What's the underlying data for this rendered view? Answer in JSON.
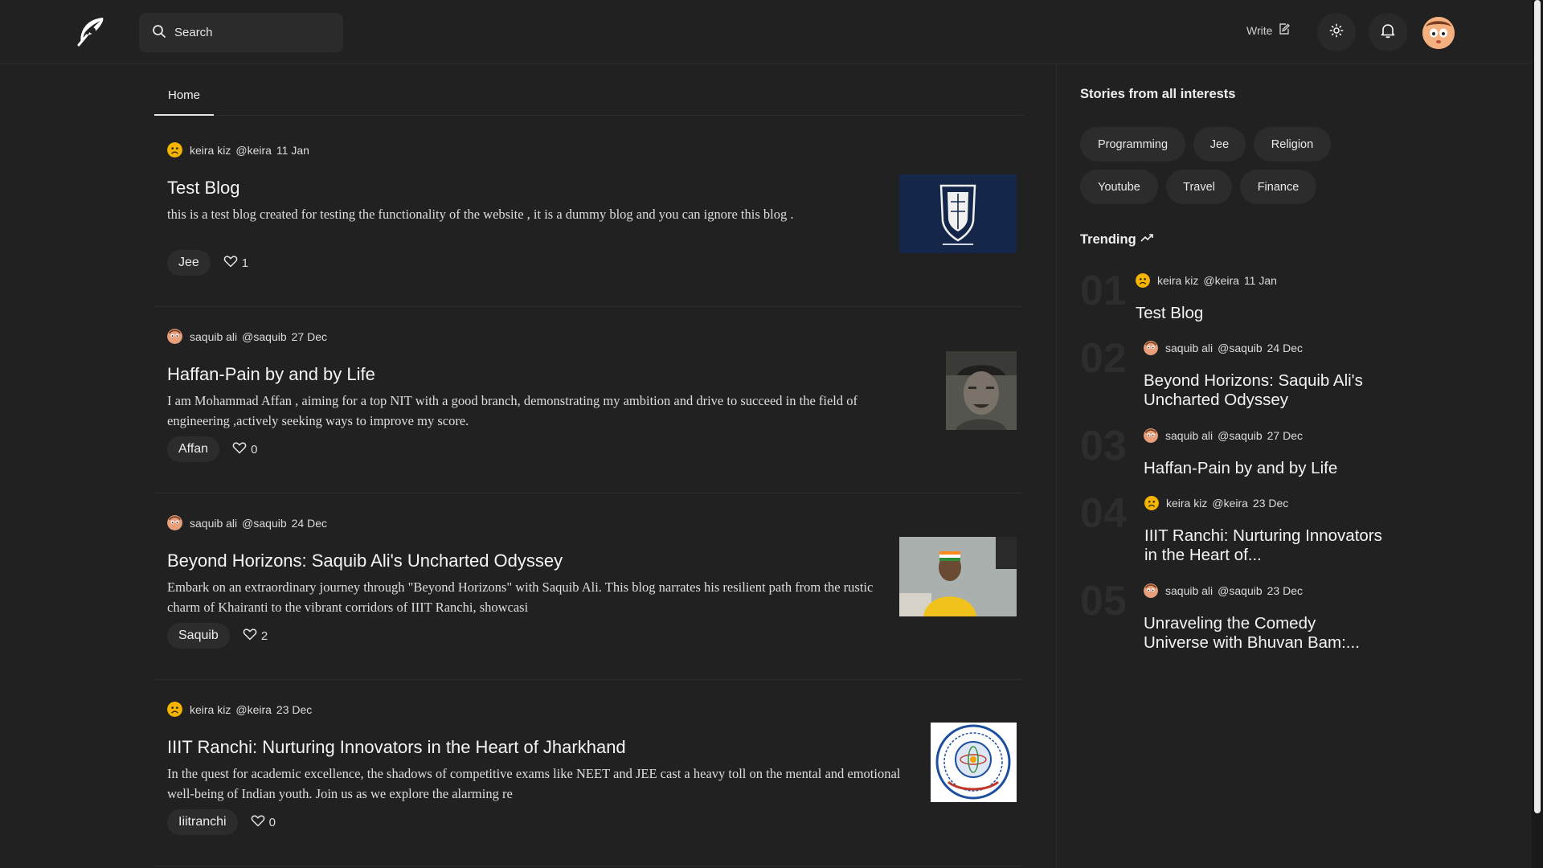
{
  "header": {
    "search_label": "Search",
    "write_label": "Write"
  },
  "tabs": [
    {
      "label": "Home"
    }
  ],
  "posts": [
    {
      "author": "keira kiz",
      "handle": "@keira",
      "date": "11 Jan",
      "title": "Test Blog",
      "excerpt": "this is a test blog created for testing the functionality of the website , it is a dummy blog and you can ignore this blog .",
      "tag": "Jee",
      "likes": "1"
    },
    {
      "author": "saquib ali",
      "handle": "@saquib",
      "date": "27 Dec",
      "title": "Haffan-Pain by and by Life",
      "excerpt": "I am Mohammad Affan , aiming for a top NIT with a good branch, demonstrating my ambition and drive to succeed in the field of engineering ,actively seeking ways to improve my score.",
      "tag": "Affan",
      "likes": "0"
    },
    {
      "author": "saquib ali",
      "handle": "@saquib",
      "date": "24 Dec",
      "title": "Beyond Horizons: Saquib Ali's Uncharted Odyssey",
      "excerpt": "Embark on an extraordinary journey through \"Beyond Horizons\" with Saquib Ali. This blog narrates his resilient path from the rustic charm of Khairanti to the vibrant corridors of IIIT Ranchi, showcasi",
      "tag": "Saquib",
      "likes": "2"
    },
    {
      "author": "keira kiz",
      "handle": "@keira",
      "date": "23 Dec",
      "title": "IIIT Ranchi: Nurturing Innovators in the Heart of Jharkhand",
      "excerpt": "In the quest for academic excellence, the shadows of competitive exams like NEET and JEE cast a heavy toll on the mental and emotional well-being of Indian youth. Join us as we explore the alarming re",
      "tag": "Iiitranchi",
      "likes": "0"
    }
  ],
  "sidebar": {
    "interests_title": "Stories from all interests",
    "interests": [
      "Programming",
      "Jee",
      "Religion",
      "Youtube",
      "Travel",
      "Finance"
    ],
    "trending_title": "Trending",
    "trending": [
      {
        "num": "01",
        "author": "keira kiz",
        "handle": "@keira",
        "date": "11 Jan",
        "title": "Test Blog"
      },
      {
        "num": "02",
        "author": "saquib ali",
        "handle": "@saquib",
        "date": "24 Dec",
        "title": "Beyond Horizons: Saquib Ali's Uncharted Odyssey"
      },
      {
        "num": "03",
        "author": "saquib ali",
        "handle": "@saquib",
        "date": "27 Dec",
        "title": "Haffan-Pain by and by Life"
      },
      {
        "num": "04",
        "author": "keira kiz",
        "handle": "@keira",
        "date": "23 Dec",
        "title": "IIIT Ranchi: Nurturing Innovators in the Heart of..."
      },
      {
        "num": "05",
        "author": "saquib ali",
        "handle": "@saquib",
        "date": "23 Dec",
        "title": "Unraveling the Comedy Universe with Bhuvan Bam:..."
      }
    ]
  },
  "icons": {
    "logo": "feather-logo-icon",
    "search": "search-icon",
    "write": "edit-icon",
    "theme": "sun-icon",
    "notifications": "bell-icon",
    "like": "heart-icon",
    "trending": "trending-up-icon"
  }
}
